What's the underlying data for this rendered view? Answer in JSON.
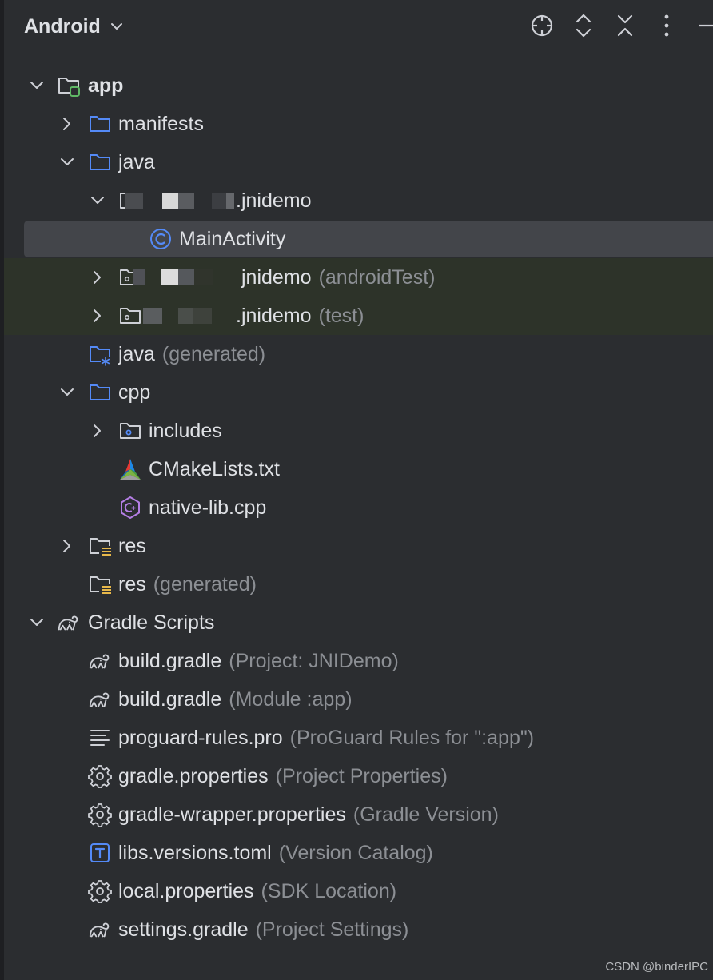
{
  "header": {
    "view_title": "Android",
    "buttons": [
      "locate-icon",
      "expand-all-icon",
      "collapse-all-icon",
      "more-icon",
      "minimize-icon"
    ]
  },
  "tree": {
    "app": {
      "label": "app"
    },
    "manifests": {
      "label": "manifests"
    },
    "java": {
      "label": "java"
    },
    "main_pkg": {
      "label_suffix": ".jnidemo"
    },
    "main_activity": {
      "label": "MainActivity"
    },
    "android_test_pkg": {
      "label_suffix": "jnidemo",
      "hint": "(androidTest)"
    },
    "test_pkg": {
      "label_suffix": ".jnidemo",
      "hint": "(test)"
    },
    "java_generated": {
      "label": "java",
      "hint": "(generated)"
    },
    "cpp": {
      "label": "cpp"
    },
    "includes": {
      "label": "includes"
    },
    "cmakelists": {
      "label": "CMakeLists.txt"
    },
    "native_lib": {
      "label": "native-lib.cpp"
    },
    "res": {
      "label": "res"
    },
    "res_generated": {
      "label": "res",
      "hint": "(generated)"
    },
    "gradle_scripts": {
      "label": "Gradle Scripts"
    },
    "build_gradle_project": {
      "label": "build.gradle",
      "hint": "(Project: JNIDemo)"
    },
    "build_gradle_module": {
      "label": "build.gradle",
      "hint": "(Module :app)"
    },
    "proguard": {
      "label": "proguard-rules.pro",
      "hint": "(ProGuard Rules for \":app\")"
    },
    "gradle_properties": {
      "label": "gradle.properties",
      "hint": "(Project Properties)"
    },
    "gradle_wrapper": {
      "label": "gradle-wrapper.properties",
      "hint": "(Gradle Version)"
    },
    "libs_versions": {
      "label": "libs.versions.toml",
      "hint": "(Version Catalog)"
    },
    "local_properties": {
      "label": "local.properties",
      "hint": "(SDK Location)"
    },
    "settings_gradle": {
      "label": "settings.gradle",
      "hint": "(Project Settings)"
    }
  },
  "watermark": "CSDN @binderIPC",
  "colors": {
    "background": "#2b2d30",
    "selection": "#43454a",
    "test_highlight": "#2d3329",
    "folder_blue": "#548af7",
    "hint_gray": "#8c8f94",
    "text": "#dfe1e5"
  }
}
